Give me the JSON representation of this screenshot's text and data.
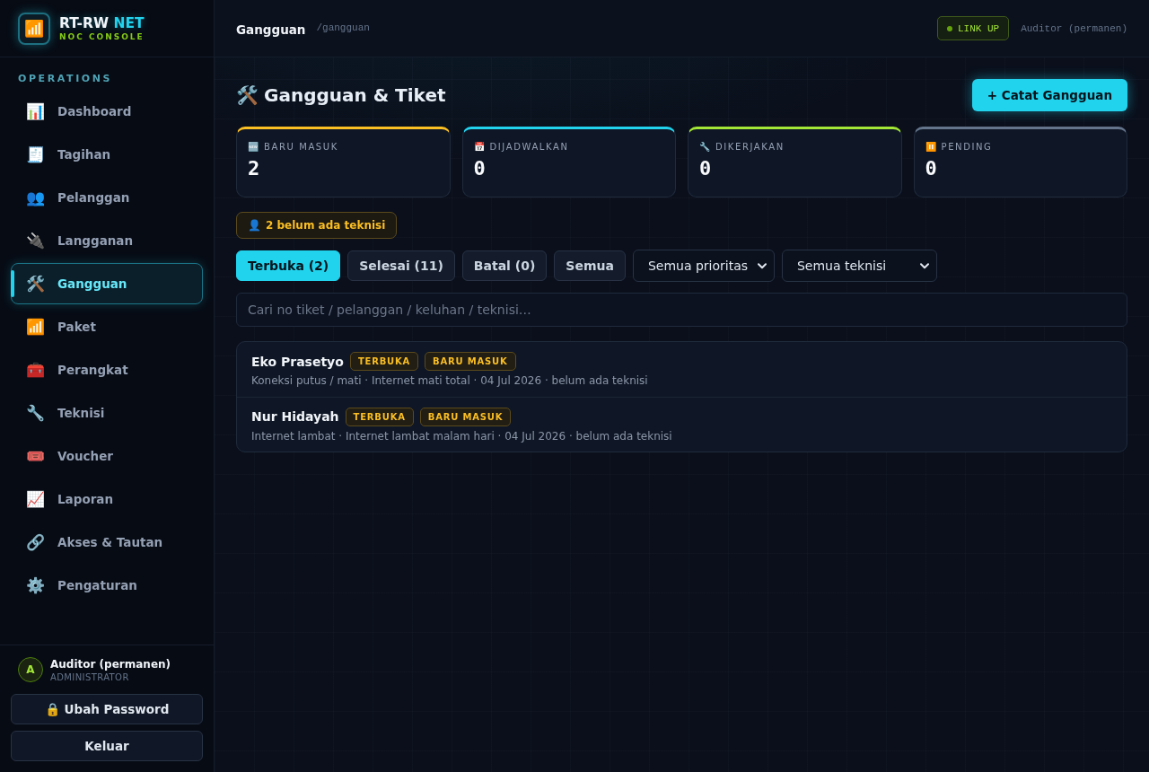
{
  "brand": {
    "icon": "📶",
    "name": "RT-RW",
    "accent": "NET",
    "subtitle": "NOC CONSOLE"
  },
  "sidebar": {
    "section": "OPERATIONS",
    "items": [
      {
        "icon": "📊",
        "label": "Dashboard",
        "selected": false
      },
      {
        "icon": "🧾",
        "label": "Tagihan",
        "selected": false
      },
      {
        "icon": "👥",
        "label": "Pelanggan",
        "selected": false
      },
      {
        "icon": "🔌",
        "label": "Langganan",
        "selected": false
      },
      {
        "icon": "🛠️",
        "label": "Gangguan",
        "selected": true
      },
      {
        "icon": "📶",
        "label": "Paket",
        "selected": false
      },
      {
        "icon": "🧰",
        "label": "Perangkat",
        "selected": false
      },
      {
        "icon": "🔧",
        "label": "Teknisi",
        "selected": false
      },
      {
        "icon": "🎟️",
        "label": "Voucher",
        "selected": false
      },
      {
        "icon": "📈",
        "label": "Laporan",
        "selected": false
      },
      {
        "icon": "🔗",
        "label": "Akses & Tautan",
        "selected": false
      },
      {
        "icon": "⚙️",
        "label": "Pengaturan",
        "selected": false
      }
    ],
    "user": {
      "avatar": "A",
      "name": "Auditor (permanen)",
      "role": "ADMINISTRATOR"
    },
    "buttons": [
      {
        "icon": "🔒",
        "label": "Ubah Password"
      },
      {
        "label": "Keluar"
      }
    ]
  },
  "topbar": {
    "title": "Gangguan",
    "path": "/gangguan",
    "status": "LINK UP",
    "user": "Auditor (permanen)"
  },
  "page": {
    "icon": "🛠️",
    "title": "Gangguan & Tiket",
    "action": "+ Catat Gangguan"
  },
  "stats": [
    {
      "icon": "🆕",
      "label": "BARU MASUK",
      "value": "2",
      "color": "#fbbf24"
    },
    {
      "icon": "📅",
      "label": "DIJADWALKAN",
      "value": "0",
      "color": "#22d3ee"
    },
    {
      "icon": "🔧",
      "label": "DIKERJAKAN",
      "value": "0",
      "color": "#a3e635"
    },
    {
      "icon": "⏸️",
      "label": "PENDING",
      "value": "0",
      "color": "#64748b"
    }
  ],
  "alert": {
    "icon": "👤",
    "text": "2 belum ada teknisi"
  },
  "tabs": [
    {
      "label": "Terbuka (2)",
      "selected": true
    },
    {
      "label": "Selesai (11)",
      "selected": false
    },
    {
      "label": "Batal (0)",
      "selected": false
    },
    {
      "label": "Semua",
      "selected": false
    }
  ],
  "filters": [
    {
      "value": "Semua prioritas"
    },
    {
      "value": "Semua teknisi"
    }
  ],
  "search": {
    "placeholder": "Cari no tiket / pelanggan / keluhan / teknisi…"
  },
  "tickets": [
    {
      "name": "Eko Prasetyo",
      "badges": [
        "TERBUKA",
        "BARU MASUK"
      ],
      "details": "Koneksi putus / mati · Internet mati total · 04 Jul 2026 · belum ada teknisi"
    },
    {
      "name": "Nur Hidayah",
      "badges": [
        "TERBUKA",
        "BARU MASUK"
      ],
      "details": "Internet lambat · Internet lambat malam hari · 04 Jul 2026 · belum ada teknisi"
    }
  ]
}
